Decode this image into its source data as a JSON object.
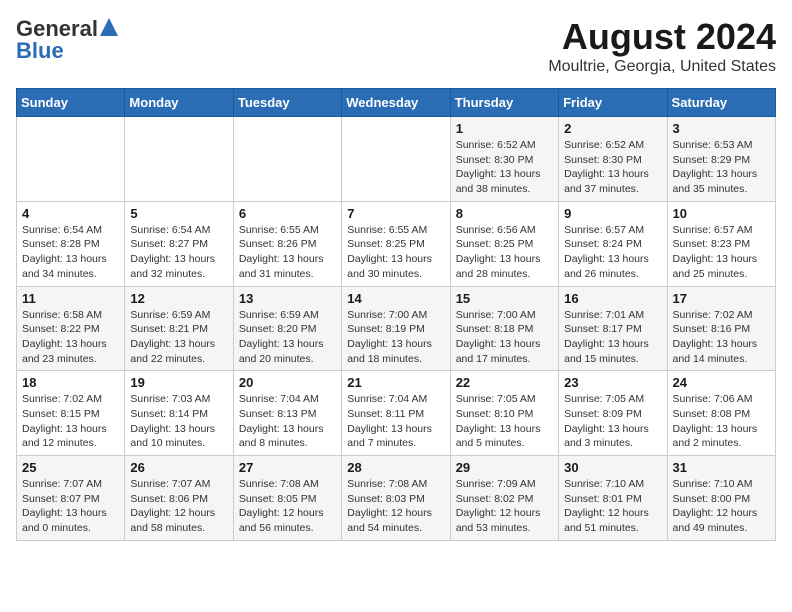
{
  "logo": {
    "line1": "General",
    "line2": "Blue"
  },
  "title": "August 2024",
  "subtitle": "Moultrie, Georgia, United States",
  "days_of_week": [
    "Sunday",
    "Monday",
    "Tuesday",
    "Wednesday",
    "Thursday",
    "Friday",
    "Saturday"
  ],
  "weeks": [
    [
      {
        "day": "",
        "info": ""
      },
      {
        "day": "",
        "info": ""
      },
      {
        "day": "",
        "info": ""
      },
      {
        "day": "",
        "info": ""
      },
      {
        "day": "1",
        "info": "Sunrise: 6:52 AM\nSunset: 8:30 PM\nDaylight: 13 hours\nand 38 minutes."
      },
      {
        "day": "2",
        "info": "Sunrise: 6:52 AM\nSunset: 8:30 PM\nDaylight: 13 hours\nand 37 minutes."
      },
      {
        "day": "3",
        "info": "Sunrise: 6:53 AM\nSunset: 8:29 PM\nDaylight: 13 hours\nand 35 minutes."
      }
    ],
    [
      {
        "day": "4",
        "info": "Sunrise: 6:54 AM\nSunset: 8:28 PM\nDaylight: 13 hours\nand 34 minutes."
      },
      {
        "day": "5",
        "info": "Sunrise: 6:54 AM\nSunset: 8:27 PM\nDaylight: 13 hours\nand 32 minutes."
      },
      {
        "day": "6",
        "info": "Sunrise: 6:55 AM\nSunset: 8:26 PM\nDaylight: 13 hours\nand 31 minutes."
      },
      {
        "day": "7",
        "info": "Sunrise: 6:55 AM\nSunset: 8:25 PM\nDaylight: 13 hours\nand 30 minutes."
      },
      {
        "day": "8",
        "info": "Sunrise: 6:56 AM\nSunset: 8:25 PM\nDaylight: 13 hours\nand 28 minutes."
      },
      {
        "day": "9",
        "info": "Sunrise: 6:57 AM\nSunset: 8:24 PM\nDaylight: 13 hours\nand 26 minutes."
      },
      {
        "day": "10",
        "info": "Sunrise: 6:57 AM\nSunset: 8:23 PM\nDaylight: 13 hours\nand 25 minutes."
      }
    ],
    [
      {
        "day": "11",
        "info": "Sunrise: 6:58 AM\nSunset: 8:22 PM\nDaylight: 13 hours\nand 23 minutes."
      },
      {
        "day": "12",
        "info": "Sunrise: 6:59 AM\nSunset: 8:21 PM\nDaylight: 13 hours\nand 22 minutes."
      },
      {
        "day": "13",
        "info": "Sunrise: 6:59 AM\nSunset: 8:20 PM\nDaylight: 13 hours\nand 20 minutes."
      },
      {
        "day": "14",
        "info": "Sunrise: 7:00 AM\nSunset: 8:19 PM\nDaylight: 13 hours\nand 18 minutes."
      },
      {
        "day": "15",
        "info": "Sunrise: 7:00 AM\nSunset: 8:18 PM\nDaylight: 13 hours\nand 17 minutes."
      },
      {
        "day": "16",
        "info": "Sunrise: 7:01 AM\nSunset: 8:17 PM\nDaylight: 13 hours\nand 15 minutes."
      },
      {
        "day": "17",
        "info": "Sunrise: 7:02 AM\nSunset: 8:16 PM\nDaylight: 13 hours\nand 14 minutes."
      }
    ],
    [
      {
        "day": "18",
        "info": "Sunrise: 7:02 AM\nSunset: 8:15 PM\nDaylight: 13 hours\nand 12 minutes."
      },
      {
        "day": "19",
        "info": "Sunrise: 7:03 AM\nSunset: 8:14 PM\nDaylight: 13 hours\nand 10 minutes."
      },
      {
        "day": "20",
        "info": "Sunrise: 7:04 AM\nSunset: 8:13 PM\nDaylight: 13 hours\nand 8 minutes."
      },
      {
        "day": "21",
        "info": "Sunrise: 7:04 AM\nSunset: 8:11 PM\nDaylight: 13 hours\nand 7 minutes."
      },
      {
        "day": "22",
        "info": "Sunrise: 7:05 AM\nSunset: 8:10 PM\nDaylight: 13 hours\nand 5 minutes."
      },
      {
        "day": "23",
        "info": "Sunrise: 7:05 AM\nSunset: 8:09 PM\nDaylight: 13 hours\nand 3 minutes."
      },
      {
        "day": "24",
        "info": "Sunrise: 7:06 AM\nSunset: 8:08 PM\nDaylight: 13 hours\nand 2 minutes."
      }
    ],
    [
      {
        "day": "25",
        "info": "Sunrise: 7:07 AM\nSunset: 8:07 PM\nDaylight: 13 hours\nand 0 minutes."
      },
      {
        "day": "26",
        "info": "Sunrise: 7:07 AM\nSunset: 8:06 PM\nDaylight: 12 hours\nand 58 minutes."
      },
      {
        "day": "27",
        "info": "Sunrise: 7:08 AM\nSunset: 8:05 PM\nDaylight: 12 hours\nand 56 minutes."
      },
      {
        "day": "28",
        "info": "Sunrise: 7:08 AM\nSunset: 8:03 PM\nDaylight: 12 hours\nand 54 minutes."
      },
      {
        "day": "29",
        "info": "Sunrise: 7:09 AM\nSunset: 8:02 PM\nDaylight: 12 hours\nand 53 minutes."
      },
      {
        "day": "30",
        "info": "Sunrise: 7:10 AM\nSunset: 8:01 PM\nDaylight: 12 hours\nand 51 minutes."
      },
      {
        "day": "31",
        "info": "Sunrise: 7:10 AM\nSunset: 8:00 PM\nDaylight: 12 hours\nand 49 minutes."
      }
    ]
  ]
}
